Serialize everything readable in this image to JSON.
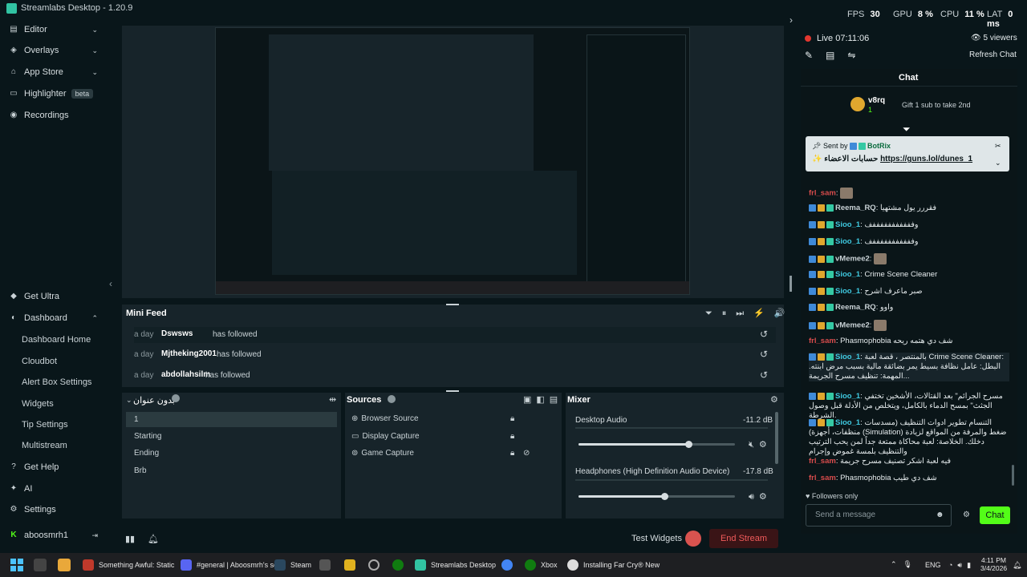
{
  "app": {
    "title": "Streamlabs Desktop - 1.20.9"
  },
  "stats": {
    "fps_label": "FPS",
    "fps": "30",
    "gpu_label": "GPU",
    "gpu": "8 %",
    "cpu_label": "CPU",
    "cpu": "11 %",
    "lat_label": "LAT",
    "lat": "0 ms"
  },
  "sidebar": {
    "top": [
      {
        "label": "Editor",
        "icon": "editor-icon"
      },
      {
        "label": "Overlays",
        "icon": "overlays-icon"
      },
      {
        "label": "App Store",
        "icon": "app-store-icon"
      },
      {
        "label": "Highlighter",
        "icon": "highlighter-icon",
        "badge": "beta"
      },
      {
        "label": "Recordings",
        "icon": "recordings-icon"
      }
    ],
    "get_ultra": "Get Ultra",
    "dashboard": "Dashboard",
    "dashboard_items": [
      "Dashboard Home",
      "Cloudbot",
      "Alert Box Settings",
      "Widgets",
      "Tip Settings",
      "Multistream"
    ],
    "get_help": "Get Help",
    "ai": "AI",
    "settings": "Settings",
    "user": "aboosmrh1"
  },
  "minifeed": {
    "title": "Mini Feed",
    "rows": [
      {
        "ago": "a day",
        "name": "Dswsws",
        "action": "has followed"
      },
      {
        "ago": "a day",
        "name": "Mjtheking2001",
        "action": "has followed"
      },
      {
        "ago": "a day",
        "name": "abdollahsilm",
        "action": "has followed"
      }
    ]
  },
  "scenes": {
    "title": "بدون عنوان",
    "items": [
      "1",
      "Starting",
      "Ending",
      "Brb"
    ]
  },
  "sources": {
    "title": "Sources",
    "items": [
      "Browser Source",
      "Display Capture",
      "Game Capture"
    ]
  },
  "mixer": {
    "title": "Mixer",
    "channels": [
      {
        "name": "Desktop Audio",
        "db": "-11.2 dB",
        "level": 0.7
      },
      {
        "name": "Headphones (High Definition Audio Device)",
        "db": "-17.8 dB",
        "level": 0.55
      }
    ]
  },
  "footer": {
    "test_widgets": "Test Widgets",
    "end_stream": "End Stream"
  },
  "live": {
    "label": "Live 07:11:06",
    "viewers": "5 viewers",
    "refresh": "Refresh Chat"
  },
  "chat": {
    "title": "Chat",
    "gift_user": "v8rq",
    "gift_count": "1",
    "gift_text": "Gift 1 sub to take 2nd",
    "pinned_by": "Sent by",
    "pinned_user": "BotRix",
    "pinned_text": "حسابات الاعضاء",
    "pinned_link": "https://guns.lol/dunes_1",
    "messages": [
      {
        "user": "frl_sam",
        "text": "",
        "color": "#d94c4c"
      },
      {
        "user": "Reema_RQ",
        "text": "فقررر يول مشتهيا",
        "color": "#c9d2d6"
      },
      {
        "user": "Sioo_1",
        "text": "وفففففففففففف",
        "color": "#3fc9e0"
      },
      {
        "user": "Sioo_1",
        "text": "وفففففففففففف",
        "color": "#3fc9e0"
      },
      {
        "user": "vMemee2",
        "text": "",
        "color": "#c9d2d6"
      },
      {
        "user": "Sioo_1",
        "text": "Crime Scene Cleaner",
        "color": "#3fc9e0"
      },
      {
        "user": "Sioo_1",
        "text": "صبر ماعرف اشرح",
        "color": "#3fc9e0"
      },
      {
        "user": "Reema_RQ",
        "text": "واوو",
        "color": "#c9d2d6"
      },
      {
        "user": "vMemee2",
        "text": "",
        "color": "#c9d2d6"
      },
      {
        "user": "frl_sam",
        "text": "Phasmophobia شف دي هتمه ريحه",
        "color": "#d94c4c"
      },
      {
        "user": "Sioo_1",
        "text": "بالمنتصر ، قصة لعبة Crime Scene Cleaner: البطل: عامل نظافة بسيط يمر بضائقة مالية بسبب مرض ابنته. المهمة: تنظيف مسرح الجريمة...",
        "color": "#3fc9e0"
      },
      {
        "user": "Sioo_1",
        "text": "مسرح الجرائم\" بعد القتالات، الأشخين تختفي الجثث\" بمسح الدماء بالكامل، ويتخلص من الأدلة قبل وصول الشرطة.",
        "color": "#3fc9e0"
      },
      {
        "user": "Sioo_1",
        "text": "التنسام تطوير ادوات التنظيف (مسدسات منظفات، أجهزة) (Simulation) ضغط والمرفة من المواقع لزيادة دخلك. الخلاصة: لعبة محاكاة ممتعة جداً لمن يحب الترتيب والتنظيف بلمسة غموض وإجرام",
        "color": "#3fc9e0"
      },
      {
        "user": "frl_sam",
        "text": "فيه لعبة اشكر تصنيف مسرح جريمة",
        "color": "#d94c4c"
      },
      {
        "user": "frl_sam",
        "text": "Phasmophobia شف دي طيب",
        "color": "#d94c4c"
      }
    ],
    "followers_only": "Followers only",
    "input_placeholder": "Send a message",
    "send": "Chat"
  },
  "taskbar": {
    "apps": [
      {
        "label": "Something Awful: Static",
        "color": "#c0392b"
      },
      {
        "label": "#general | Aboosmrh's se",
        "color": "#5865f2"
      },
      {
        "label": "Steam",
        "color": "#1b2838"
      },
      {
        "label": "Streamlabs Desktop",
        "color": "#31c3a2"
      },
      {
        "label": "Xbox",
        "color": "#107c10"
      },
      {
        "label": "Installing Far Cry® New",
        "color": "#e0e0e0"
      }
    ],
    "lang": "ENG",
    "time": "4:11 PM",
    "date": "3/4/2026"
  }
}
